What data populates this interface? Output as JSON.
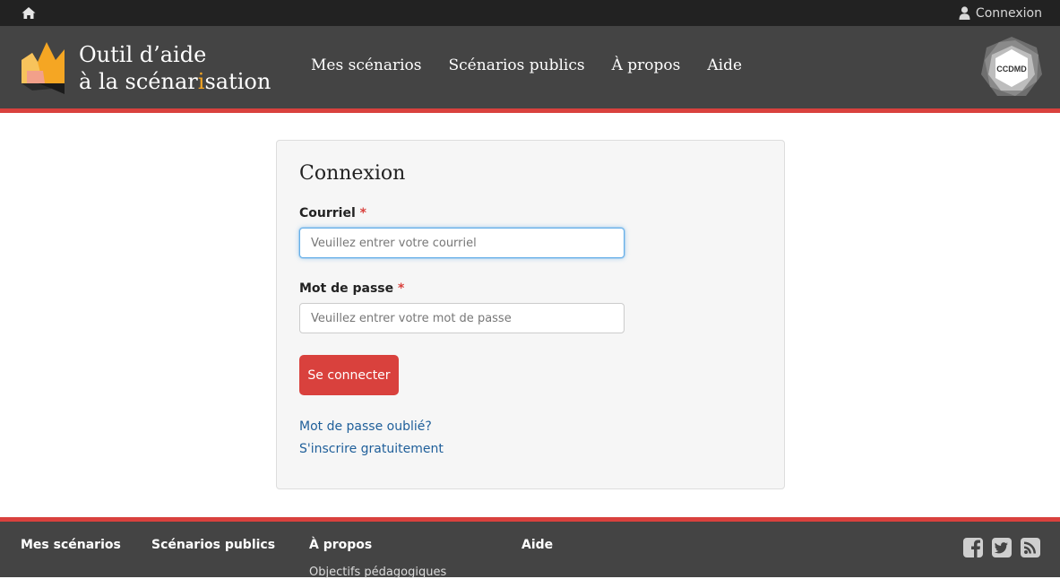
{
  "topbar": {
    "home_icon": "home-icon",
    "login_icon": "user-icon",
    "login_label": "Connexion"
  },
  "header": {
    "logo_line1": "Outil d’aide",
    "logo_line2_a": "à la scénar",
    "logo_line2_b": "i",
    "logo_line2_c": "sation",
    "nav": [
      "Mes scénarios",
      "Scénarios publics",
      "À propos",
      "Aide"
    ],
    "partner_logo_text": "CCDMD"
  },
  "login": {
    "title": "Connexion",
    "email_label": "Courriel",
    "email_placeholder": "Veuillez entrer votre courriel",
    "password_label": "Mot de passe",
    "password_placeholder": "Veuillez entrer votre mot de passe",
    "required_mark": "*",
    "submit_label": "Se connecter",
    "forgot_link": "Mot de passe oublié?",
    "register_link": "S'inscrire gratuitement"
  },
  "footer": {
    "columns": [
      "Mes scénarios",
      "Scénarios publics",
      "À propos",
      "Aide"
    ],
    "about_sub": "Objectifs pédagogiques",
    "social_icons": [
      "facebook-icon",
      "twitter-icon",
      "rss-icon"
    ]
  },
  "colors": {
    "accent_red": "#d9413d",
    "header_bg": "#444444",
    "topbar_bg": "#222222",
    "link_blue": "#1f5f9a",
    "logo_orange": "#f5a623"
  }
}
